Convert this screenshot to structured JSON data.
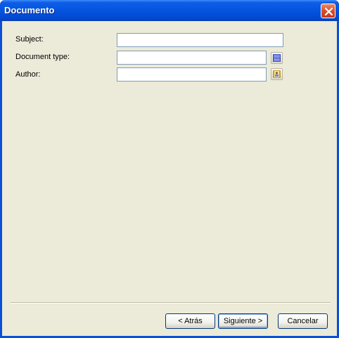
{
  "window": {
    "title": "Documento"
  },
  "form": {
    "subject_label": "Subject:",
    "subject_value": "",
    "document_type_label": "Document type:",
    "document_type_value": "",
    "author_label": "Author:",
    "author_value": ""
  },
  "icons": {
    "document_type_picker": "list-icon",
    "author_picker": "address-book-icon"
  },
  "buttons": {
    "back": "< Atrás",
    "next": "Siguiente >",
    "cancel": "Cancelar"
  },
  "colors": {
    "titlebar": "#0454e0",
    "client_bg": "#ecead8",
    "close_button": "#d9512f"
  }
}
